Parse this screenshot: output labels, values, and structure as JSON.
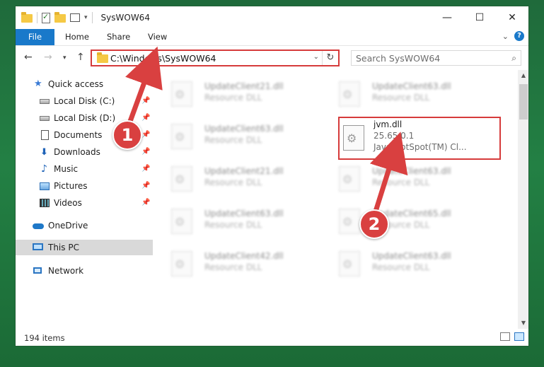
{
  "window": {
    "title": "SysWOW64",
    "controls": {
      "minimize": "—",
      "maximize": "☐",
      "close": "✕"
    }
  },
  "ribbon": {
    "tabs": [
      "File",
      "Home",
      "Share",
      "View"
    ],
    "expand_glyph": "⌄",
    "help_glyph": "?"
  },
  "address_bar": {
    "path": "C:\\Windows\\SysWOW64",
    "search_placeholder": "Search SysWOW64"
  },
  "nav_pane": {
    "items": [
      {
        "label": "Quick access",
        "icon": "star-icon"
      },
      {
        "label": "Local Disk (C:)",
        "icon": "drive-icon",
        "pinned": true
      },
      {
        "label": "Local Disk (D:)",
        "icon": "drive-icon",
        "pinned": true
      },
      {
        "label": "Documents",
        "icon": "documents-icon",
        "pinned": true
      },
      {
        "label": "Downloads",
        "icon": "downloads-icon",
        "pinned": true
      },
      {
        "label": "Music",
        "icon": "music-icon",
        "pinned": true
      },
      {
        "label": "Pictures",
        "icon": "pictures-icon",
        "pinned": true
      },
      {
        "label": "Videos",
        "icon": "videos-icon",
        "pinned": true
      },
      {
        "label": "OneDrive",
        "icon": "onedrive-icon"
      },
      {
        "label": "This PC",
        "icon": "pc-icon",
        "selected": true
      },
      {
        "label": "Network",
        "icon": "network-icon"
      }
    ]
  },
  "files": [
    {
      "name": "UpdateClient21.dll",
      "desc": "Resource DLL"
    },
    {
      "name": "UpdateClient63.dll",
      "desc": "Resource DLL"
    },
    {
      "name": "UpdateClient63.dll",
      "desc": "Resource DLL"
    },
    {
      "name": "jvm.dll",
      "version": "25.65.0.1",
      "desc": "Java HotSpot(TM) Cl...",
      "highlighted": true
    },
    {
      "name": "UpdateClient21.dll",
      "desc": "Resource DLL"
    },
    {
      "name": "UpdateClient63.dll",
      "desc": "Resource DLL"
    },
    {
      "name": "UpdateClient63.dll",
      "desc": "Resource DLL"
    },
    {
      "name": "UpdateClient65.dll",
      "desc": "Resource DLL"
    },
    {
      "name": "UpdateClient42.dll",
      "desc": "Resource DLL"
    },
    {
      "name": "UpdateClient63.dll",
      "desc": "Resource DLL"
    }
  ],
  "status": {
    "item_count": "194 items"
  },
  "annotations": {
    "step1": "1",
    "step2": "2",
    "color": "#d94040"
  },
  "colors": {
    "accent": "#1979ca",
    "highlight_border": "#d63b3b",
    "desktop": "#238044"
  }
}
